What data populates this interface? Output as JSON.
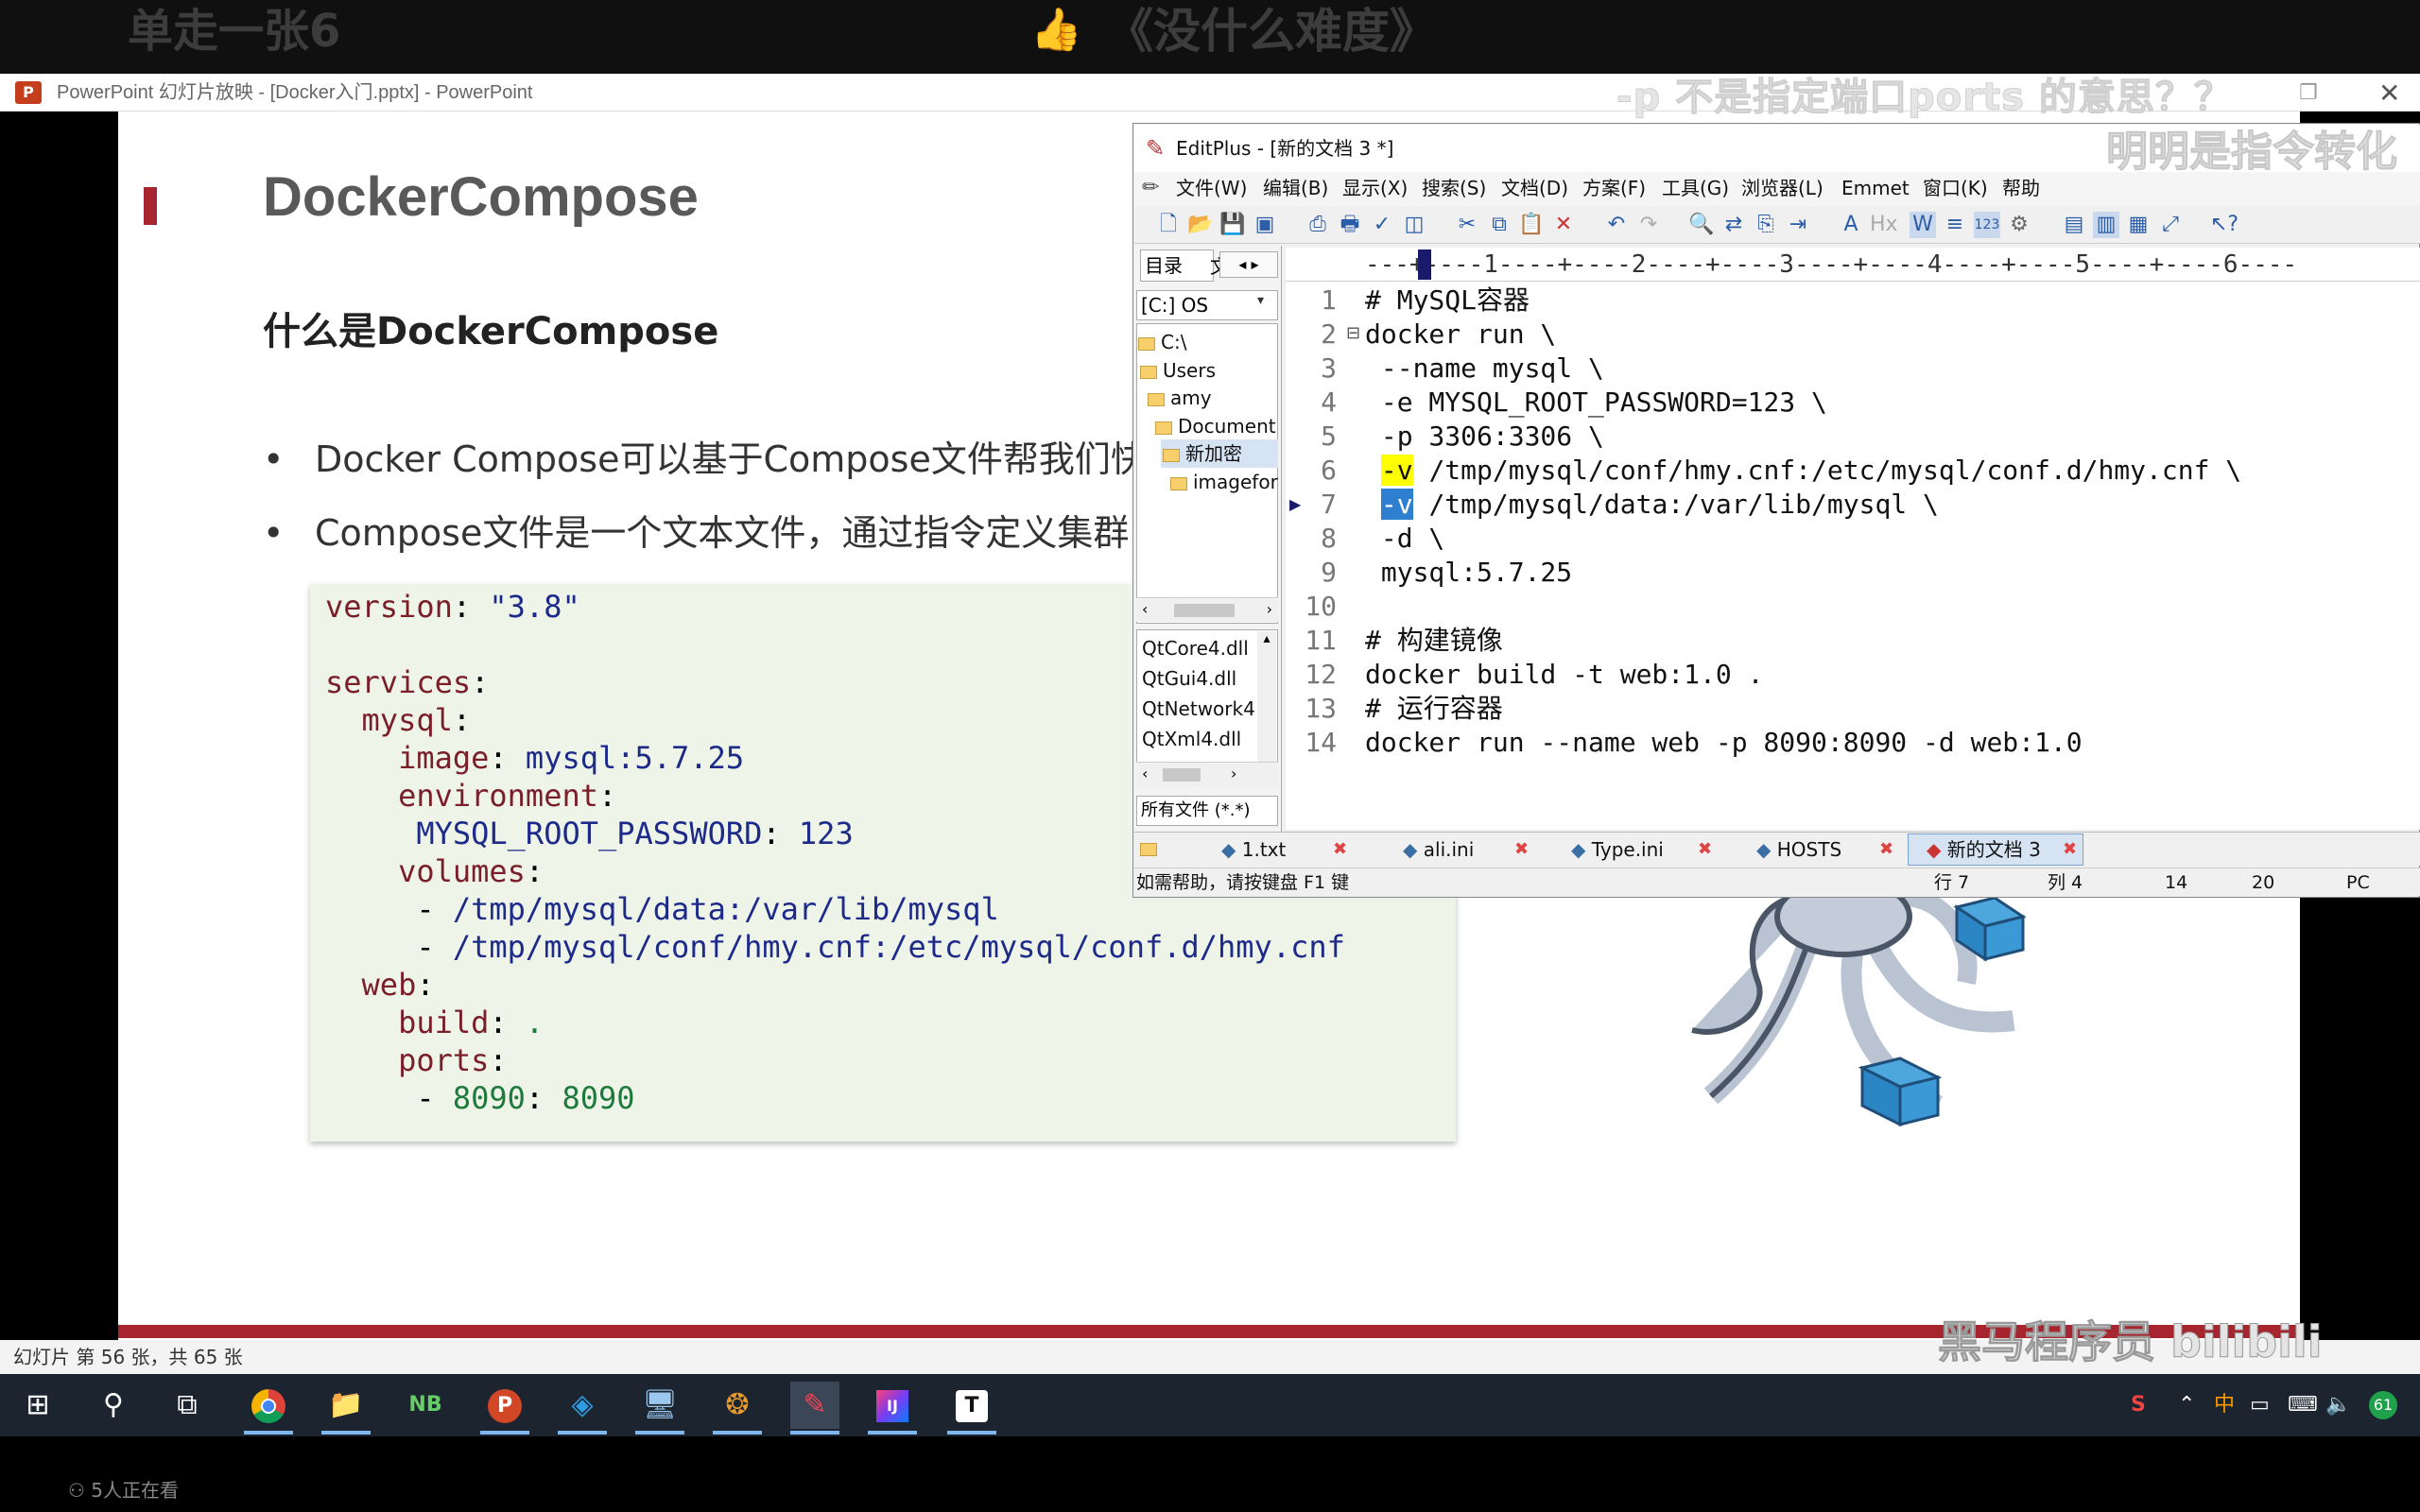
{
  "banner": {
    "left_text": "单走一张6",
    "center_text": "《没什么难度》"
  },
  "overlays": {
    "question": "-p 不是指定端口ports 的意思？？",
    "reply": "明明是指令转化"
  },
  "ppt": {
    "window_title": "PowerPoint 幻灯片放映 - [Docker入门.pptx] - PowerPoint",
    "status": "幻灯片 第 56 张，共 65 张",
    "watermark": "黑马程序员 bilibili"
  },
  "slide": {
    "title": "DockerCompose",
    "subtitle": "什么是DockerCompose",
    "bullets": [
      "Docker Compose可以基于Compose文件帮我们快速",
      "Compose文件是一个文本文件，通过指令定义集群中"
    ],
    "code": {
      "l1_key": "version",
      "l1_val": "\"3.8\"",
      "l2_key": "services",
      "l3_key": "mysql",
      "l4_key": "image",
      "l4_val": "mysql:5.7.25",
      "l5_key": "environment",
      "l6_key": "MYSQL_ROOT_PASSWORD",
      "l6_val": "123",
      "l7_key": "volumes",
      "l8_val": "/tmp/mysql/data:/var/lib/mysql",
      "l9_val": "/tmp/mysql/conf/hmy.cnf:/etc/mysql/conf.d/hmy.cnf",
      "l10_key": "web",
      "l11_key": "build",
      "l11_val": ".",
      "l12_key": "ports",
      "l13_val": "8090",
      "l13_val2": "8090"
    }
  },
  "editplus": {
    "title": "EditPlus - [新的文档 3 *]",
    "menu": [
      "文件(W)",
      "编辑(B)",
      "显示(X)",
      "搜索(S)",
      "文档(D)",
      "方案(F)",
      "工具(G)",
      "浏览器(L)",
      "Emmet",
      "窗口(K)",
      "帮助"
    ],
    "left_tab": "目录",
    "left_tab2": "文",
    "drive": "[C:] OS",
    "tree": [
      "C:\\",
      "Users",
      "amy",
      "Document",
      "新加密",
      "imagefor"
    ],
    "files": [
      "QtCore4.dll",
      "QtGui4.dll",
      "QtNetwork4",
      "QtXml4.dll"
    ],
    "filter": "所有文件 (*.*)",
    "ruler": "---+----1----+----2----+----3----+----4----+----5----+----6----",
    "line_numbers": [
      "1",
      "2",
      "3",
      "4",
      "5",
      "6",
      "7",
      "8",
      "9",
      "10",
      "11",
      "12",
      "13",
      "14"
    ],
    "code_lines": [
      "# MySQL容器",
      "docker run \\",
      " --name mysql \\",
      " -e MYSQL_ROOT_PASSWORD=123 \\",
      " -p 3306:3306 \\",
      "/tmp/mysql/conf/hmy.cnf:/etc/mysql/conf.d/hmy.cnf \\",
      "/tmp/mysql/data:/var/lib/mysql \\",
      " -d \\",
      " mysql:5.7.25",
      "",
      "# 构建镜像",
      "docker build -t web:1.0 .",
      "# 运行容器",
      "docker run --name web -p 8090:8090 -d web:1.0"
    ],
    "flag_v": "-v",
    "tabs": [
      "1.txt",
      "ali.ini",
      "Type.ini",
      "HOSTS",
      "新的文档 3"
    ],
    "status": {
      "help": "如需帮助，请按键盘 F1 键",
      "row": "行 7",
      "col": "列 4",
      "n1": "14",
      "n2": "20",
      "mode": "PC"
    }
  },
  "taskbar": {
    "icons": [
      "windows-start",
      "search",
      "task-view",
      "chrome",
      "file-explorer",
      "notebook",
      "powerpoint",
      "virtualbox",
      "remote-desktop",
      "color-app",
      "editplus",
      "intellij",
      "typora"
    ],
    "tray_temp": "61"
  },
  "viewers": "5人正在看"
}
